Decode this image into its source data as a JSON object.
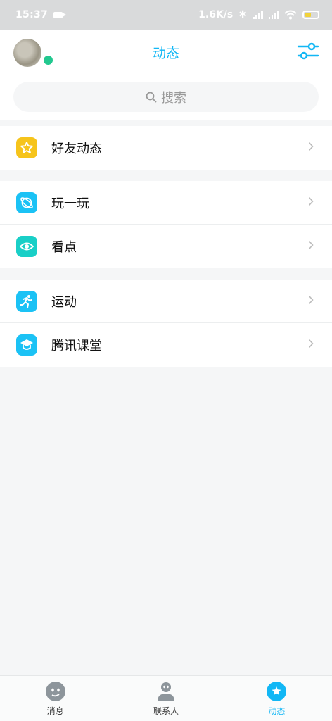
{
  "status_bar": {
    "time": "15:37",
    "network_speed": "1.6K/s",
    "battery_level": 0.4
  },
  "header": {
    "title": "动态",
    "accent_color": "#12b7f5",
    "online_status_color": "#22c88f"
  },
  "search": {
    "placeholder": "搜索"
  },
  "sections": [
    {
      "items": [
        {
          "label": "好友动态",
          "icon": "star-icon",
          "color": "#f6c41b"
        }
      ]
    },
    {
      "items": [
        {
          "label": "玩一玩",
          "icon": "planet-icon",
          "color": "#1bc2f5"
        },
        {
          "label": "看点",
          "icon": "eye-icon",
          "color": "#19cfc7"
        }
      ]
    },
    {
      "items": [
        {
          "label": "运动",
          "icon": "running-icon",
          "color": "#1bc2f5"
        },
        {
          "label": "腾讯课堂",
          "icon": "graduation-cap-icon",
          "color": "#1bc2f5"
        }
      ]
    }
  ],
  "bottom_nav": {
    "tabs": [
      {
        "label": "消息",
        "icon": "message-face-icon",
        "active": false
      },
      {
        "label": "联系人",
        "icon": "contacts-person-icon",
        "active": false
      },
      {
        "label": "动态",
        "icon": "star-circle-icon",
        "active": true
      }
    ]
  }
}
